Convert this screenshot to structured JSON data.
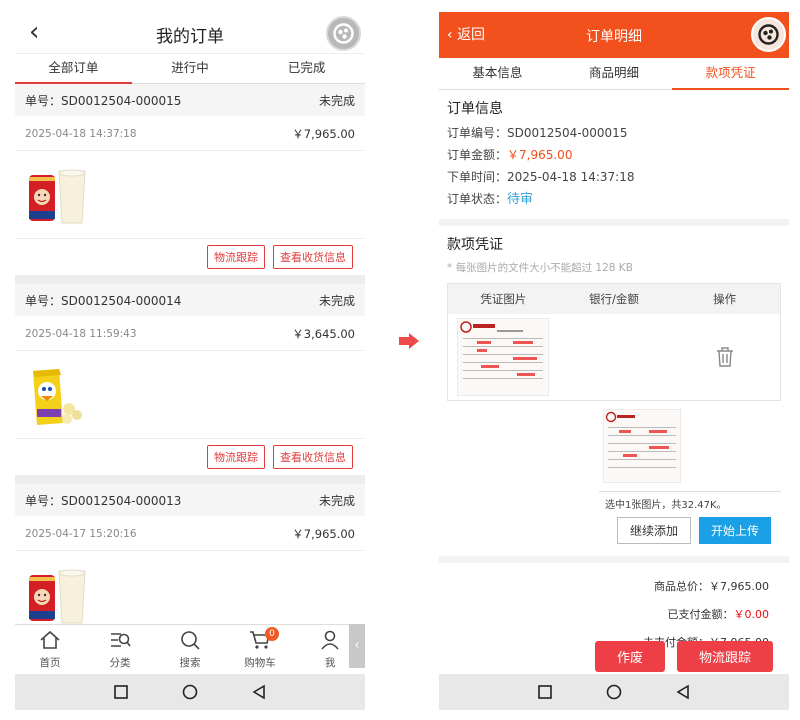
{
  "left": {
    "header": {
      "title": "我的订单"
    },
    "tabs": [
      {
        "label": "全部订单",
        "active": true
      },
      {
        "label": "进行中",
        "active": false
      },
      {
        "label": "已完成",
        "active": false
      }
    ],
    "orders": [
      {
        "number_label": "单号：SD0012504-000015",
        "status": "未完成",
        "time": "2025-04-18  14:37:18",
        "price": "￥7,965.00",
        "product": "milk-can-product"
      },
      {
        "number_label": "单号：SD0012504-000014",
        "status": "未完成",
        "time": "2025-04-18  11:59:43",
        "price": "￥3,645.00",
        "product": "juice-box-product"
      },
      {
        "number_label": "单号：SD0012504-000013",
        "status": "未完成",
        "time": "2025-04-17  15:20:16",
        "price": "￥7,965.00",
        "product": "milk-can-product"
      }
    ],
    "actions": {
      "track": "物流跟踪",
      "address": "查看收货信息"
    },
    "bottom_nav": [
      {
        "label": "首页",
        "icon": "home-icon"
      },
      {
        "label": "分类",
        "icon": "category-icon"
      },
      {
        "label": "搜索",
        "icon": "search-icon"
      },
      {
        "label": "购物车",
        "icon": "cart-icon",
        "badge": "0"
      },
      {
        "label": "我",
        "icon": "user-icon"
      }
    ]
  },
  "right": {
    "header": {
      "back": "返回",
      "title": "订单明细"
    },
    "tabs": [
      {
        "label": "基本信息"
      },
      {
        "label": "商品明细"
      },
      {
        "label": "款项凭证",
        "active": true
      }
    ],
    "order_info": {
      "title": "订单信息",
      "number_label": "订单编号：",
      "number": "SD0012504-000015",
      "amount_label": "订单金额：",
      "amount": "￥7,965.00",
      "time_label": "下单时间：",
      "time": "2025-04-18  14:37:18",
      "status_label": "订单状态：",
      "status": "待审"
    },
    "voucher": {
      "title": "款项凭证",
      "hint": "* 每张图片的文件大小不能超过  128 KB",
      "columns": [
        "凭证图片",
        "银行/金额",
        "操作"
      ],
      "selected_text": "选中1张图片，共32.47K。",
      "continue_btn": "继续添加",
      "upload_btn": "开始上传"
    },
    "totals": {
      "goods_label": "商品总价：",
      "goods": "￥7,965.00",
      "paid_label": "已支付金额：",
      "paid": "￥0.00",
      "unpaid_label": "未支付金额：",
      "unpaid": "￥7,965.00"
    },
    "buttons": {
      "void": "作废",
      "track": "物流跟踪"
    }
  },
  "colors": {
    "accent_red": "#e23c3c",
    "header_orange": "#f2501c",
    "blue": "#1aa0e6"
  }
}
